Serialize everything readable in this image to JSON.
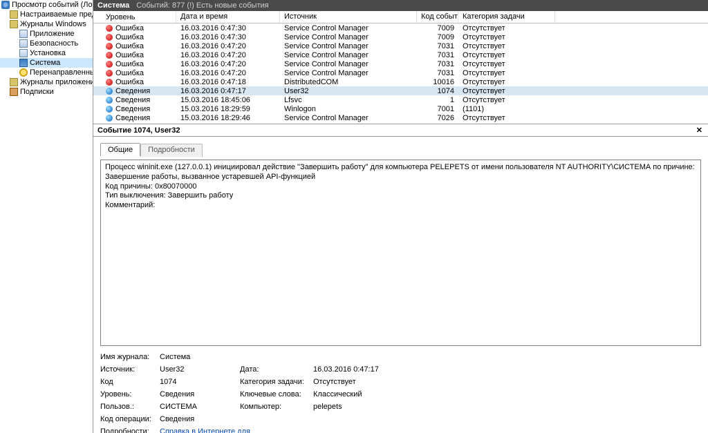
{
  "tree": {
    "root": "Просмотр событий (Локальн",
    "custom": "Настраиваемые представл",
    "winlogs": "Журналы Windows",
    "items": [
      "Приложение",
      "Безопасность",
      "Установка",
      "Система",
      "Перенаправленные соб"
    ],
    "applogs": "Журналы приложений и сл",
    "subscriptions": "Подписки"
  },
  "titlebar": {
    "name": "Система",
    "count": "Событий: 877 (!) Есть новые события"
  },
  "columns": {
    "level": "Уровень",
    "date": "Дата и время",
    "source": "Источник",
    "id": "Код события",
    "task": "Категория задачи"
  },
  "rows": [
    {
      "icon": "err",
      "level": "Ошибка",
      "date": "16.03.2016 0:47:30",
      "src": "Service Control Manager",
      "id": "7009",
      "task": "Отсутствует",
      "sel": false
    },
    {
      "icon": "err",
      "level": "Ошибка",
      "date": "16.03.2016 0:47:30",
      "src": "Service Control Manager",
      "id": "7009",
      "task": "Отсутствует",
      "sel": false
    },
    {
      "icon": "err",
      "level": "Ошибка",
      "date": "16.03.2016 0:47:20",
      "src": "Service Control Manager",
      "id": "7031",
      "task": "Отсутствует",
      "sel": false
    },
    {
      "icon": "err",
      "level": "Ошибка",
      "date": "16.03.2016 0:47:20",
      "src": "Service Control Manager",
      "id": "7031",
      "task": "Отсутствует",
      "sel": false
    },
    {
      "icon": "err",
      "level": "Ошибка",
      "date": "16.03.2016 0:47:20",
      "src": "Service Control Manager",
      "id": "7031",
      "task": "Отсутствует",
      "sel": false
    },
    {
      "icon": "err",
      "level": "Ошибка",
      "date": "16.03.2016 0:47:20",
      "src": "Service Control Manager",
      "id": "7031",
      "task": "Отсутствует",
      "sel": false
    },
    {
      "icon": "err",
      "level": "Ошибка",
      "date": "16.03.2016 0:47:18",
      "src": "DistributedCOM",
      "id": "10016",
      "task": "Отсутствует",
      "sel": false
    },
    {
      "icon": "info",
      "level": "Сведения",
      "date": "16.03.2016 0:47:17",
      "src": "User32",
      "id": "1074",
      "task": "Отсутствует",
      "sel": true
    },
    {
      "icon": "info",
      "level": "Сведения",
      "date": "15.03.2016 18:45:06",
      "src": "Lfsvc",
      "id": "1",
      "task": "Отсутствует",
      "sel": false
    },
    {
      "icon": "info",
      "level": "Сведения",
      "date": "15.03.2016 18:29:59",
      "src": "Winlogon",
      "id": "7001",
      "task": "(1101)",
      "sel": false
    },
    {
      "icon": "info",
      "level": "Сведения",
      "date": "15.03.2016 18:29:46",
      "src": "Service Control Manager",
      "id": "7026",
      "task": "Отсутствует",
      "sel": false
    }
  ],
  "details": {
    "title": "Событие 1074, User32",
    "tabs": {
      "general": "Общие",
      "more": "Подробности"
    },
    "desc1": "Процесс wininit.exe (127.0.0.1) инициировал действие \"Завершить работу\" для компьютера PELEPETS от имени пользователя NT AUTHORITY\\СИСТЕМА по причине: Завершение работы, вызванное устаревшей API-функцией",
    "desc2": "Код причины: 0x80070000",
    "desc3": "Тип выключения: Завершить работу",
    "desc4": "Комментарий:",
    "meta": {
      "logname_k": "Имя журнала:",
      "logname_v": "Система",
      "source_k": "Источник:",
      "source_v": "User32",
      "date_k": "Дата:",
      "date_v": "16.03.2016 0:47:17",
      "code_k": "Код",
      "code_v": "1074",
      "taskcat_k": "Категория задачи:",
      "taskcat_v": "Отсутствует",
      "level_k": "Уровень:",
      "level_v": "Сведения",
      "keywords_k": "Ключевые слова:",
      "keywords_v": "Классический",
      "user_k": "Пользов.:",
      "user_v": "СИСТЕМА",
      "computer_k": "Компьютер:",
      "computer_v": "pelepets",
      "opcode_k": "Код операции:",
      "opcode_v": "Сведения",
      "moreinfo_k": "Подробности:",
      "moreinfo_v": "Справка в Интернете для"
    }
  }
}
